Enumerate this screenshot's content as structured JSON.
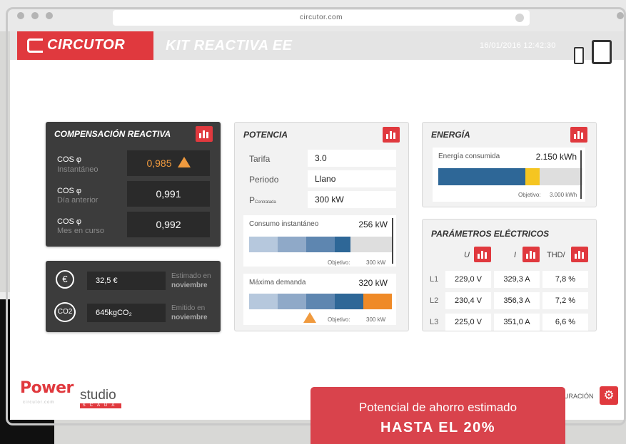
{
  "browser": {
    "url": "circutor.com"
  },
  "header": {
    "brand": "CIRCUTOR",
    "title": "KIT REACTIVA EE",
    "datetime": "16/01/2016  12:42:30",
    "brand_color": "#e0393e"
  },
  "compensacion": {
    "title": "COMPENSACIÓN REACTIVA",
    "rows": [
      {
        "label": "COS φ",
        "sub": "Instantáneo",
        "value": "0,985",
        "warning": true
      },
      {
        "label": "COS φ",
        "sub": "Día anterior",
        "value": "0,991"
      },
      {
        "label": "COS φ",
        "sub": "Mes en curso",
        "value": "0,992"
      }
    ]
  },
  "ahorro": {
    "money": {
      "value": "32,5 €",
      "note_1": "Estimado en",
      "note_2": "noviembre"
    },
    "co2": {
      "icon_text": "CO2",
      "value": "645kgCO₂",
      "note_1": "Emitido en",
      "note_2": "noviembre"
    }
  },
  "potencia": {
    "title": "POTENCIA",
    "rows": [
      {
        "label": "Tarifa",
        "value": "3.0"
      },
      {
        "label": "Periodo",
        "value": "Llano"
      },
      {
        "label": "P",
        "label_sub": "Contratada",
        "value": "300 kW"
      }
    ],
    "consumo": {
      "label": "Consumo instantáneo",
      "value": "256 kW",
      "objetivo_label": "Objetivo:",
      "objetivo_value": "300 kW",
      "fraction": 0.72
    },
    "maxima": {
      "label": "Máxima demanda",
      "value": "320 kW",
      "objetivo_label": "Objetivo:",
      "objetivo_value": "300 kW",
      "fraction": 1.0
    }
  },
  "energia": {
    "title": "ENERGÍA",
    "label": "Energía consumida",
    "value": "2.150 kWh",
    "objetivo_label": "Objetivo:",
    "objetivo_value": "3.000 kWh",
    "fraction": 0.72
  },
  "parametros": {
    "title": "PARÁMETROS ELÉCTRICOS",
    "columns": [
      "U",
      "I",
      "THD/"
    ],
    "rows": [
      {
        "line": "L1",
        "u": "229,0 V",
        "i": "329,3 A",
        "thd": "7,8 %"
      },
      {
        "line": "L2",
        "u": "230,4 V",
        "i": "356,3 A",
        "thd": "7,2 %"
      },
      {
        "line": "L3",
        "u": "225,0 V",
        "i": "351,0 A",
        "thd": "6,6 %"
      }
    ]
  },
  "footer": {
    "logo_power": "Power",
    "logo_studio": "studio",
    "logo_sub": "circutor.com",
    "logo_scada": "SCADA",
    "config_label": "URACIÓN"
  },
  "promo": {
    "line_1": "Potencial de ahorro estimado",
    "line_2": "HASTA EL 20%"
  }
}
